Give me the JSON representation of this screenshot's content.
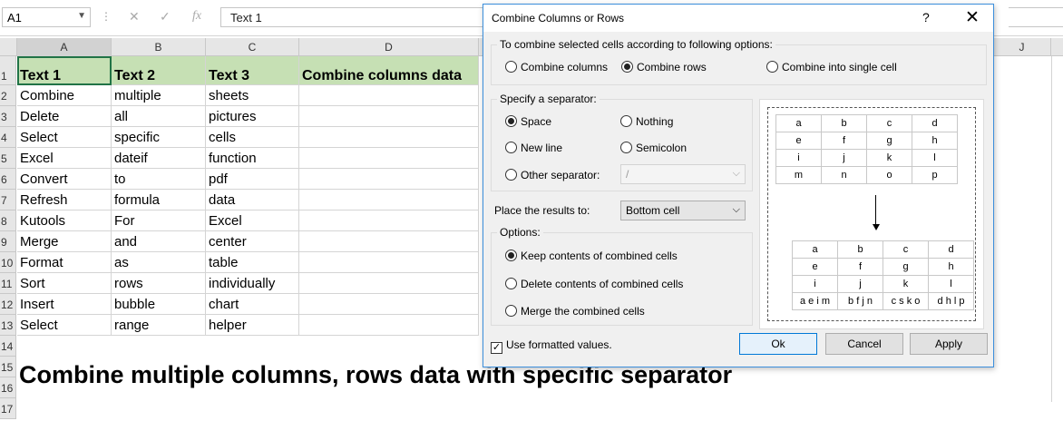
{
  "formula_bar": {
    "name_box": "A1",
    "dots": "⋮",
    "cancel_glyph": "✕",
    "enter_glyph": "✓",
    "fx_glyph": "fx",
    "formula": "Text 1"
  },
  "sheet": {
    "columns": [
      "A",
      "B",
      "C",
      "D",
      "J"
    ],
    "rows": [
      "1",
      "2",
      "3",
      "4",
      "5",
      "6",
      "7",
      "8",
      "9",
      "10",
      "11",
      "12",
      "13",
      "14",
      "15",
      "16",
      "17"
    ],
    "header": [
      "Text 1",
      "Text 2",
      "Text 3",
      "Combine columns data"
    ],
    "data": [
      [
        "Combine",
        "multiple",
        "sheets"
      ],
      [
        "Delete",
        "all",
        "pictures"
      ],
      [
        "Select",
        "specific",
        "cells"
      ],
      [
        "Excel",
        "dateif",
        "function"
      ],
      [
        "Convert",
        "to",
        "pdf"
      ],
      [
        "Refresh",
        "formula",
        "data"
      ],
      [
        "Kutools",
        "For",
        "Excel"
      ],
      [
        "Merge",
        "and",
        "center"
      ],
      [
        "Format",
        "as",
        "table"
      ],
      [
        "Sort",
        "rows",
        "individually"
      ],
      [
        "Insert",
        "bubble",
        "chart"
      ],
      [
        "Select",
        "range",
        "helper"
      ]
    ],
    "caption": "Combine multiple columns, rows data with specific separator"
  },
  "dialog": {
    "title": "Combine Columns or Rows",
    "help_glyph": "?",
    "close_glyph": "✕",
    "combine_group": {
      "title": "To combine selected cells according to following options:",
      "options": [
        "Combine columns",
        "Combine rows",
        "Combine into single cell"
      ],
      "selected_index": 1
    },
    "separator_group": {
      "title": "Specify a separator:",
      "space": "Space",
      "nothing": "Nothing",
      "new_line": "New line",
      "semicolon": "Semicolon",
      "other": "Other separator:",
      "other_value": "/",
      "selected": "space"
    },
    "place": {
      "label": "Place the results to:",
      "value": "Bottom cell"
    },
    "options_group": {
      "title": "Options:",
      "items": [
        "Keep contents of combined cells",
        "Delete contents of combined cells",
        "Merge the combined cells"
      ],
      "selected_index": 0
    },
    "use_formatted": "Use formatted values.",
    "check_glyph": "✓",
    "buttons": {
      "ok": "Ok",
      "cancel": "Cancel",
      "apply": "Apply"
    },
    "preview": {
      "top": [
        [
          "a",
          "b",
          "c",
          "d"
        ],
        [
          "e",
          "f",
          "g",
          "h"
        ],
        [
          "i",
          "j",
          "k",
          "l"
        ],
        [
          "m",
          "n",
          "o",
          "p"
        ]
      ],
      "bottom": [
        [
          "a",
          "b",
          "c",
          "d"
        ],
        [
          "e",
          "f",
          "g",
          "h"
        ],
        [
          "i",
          "j",
          "k",
          "l"
        ],
        [
          "a e i m",
          "b f j n",
          "c s k o",
          "d h l p"
        ]
      ]
    }
  }
}
